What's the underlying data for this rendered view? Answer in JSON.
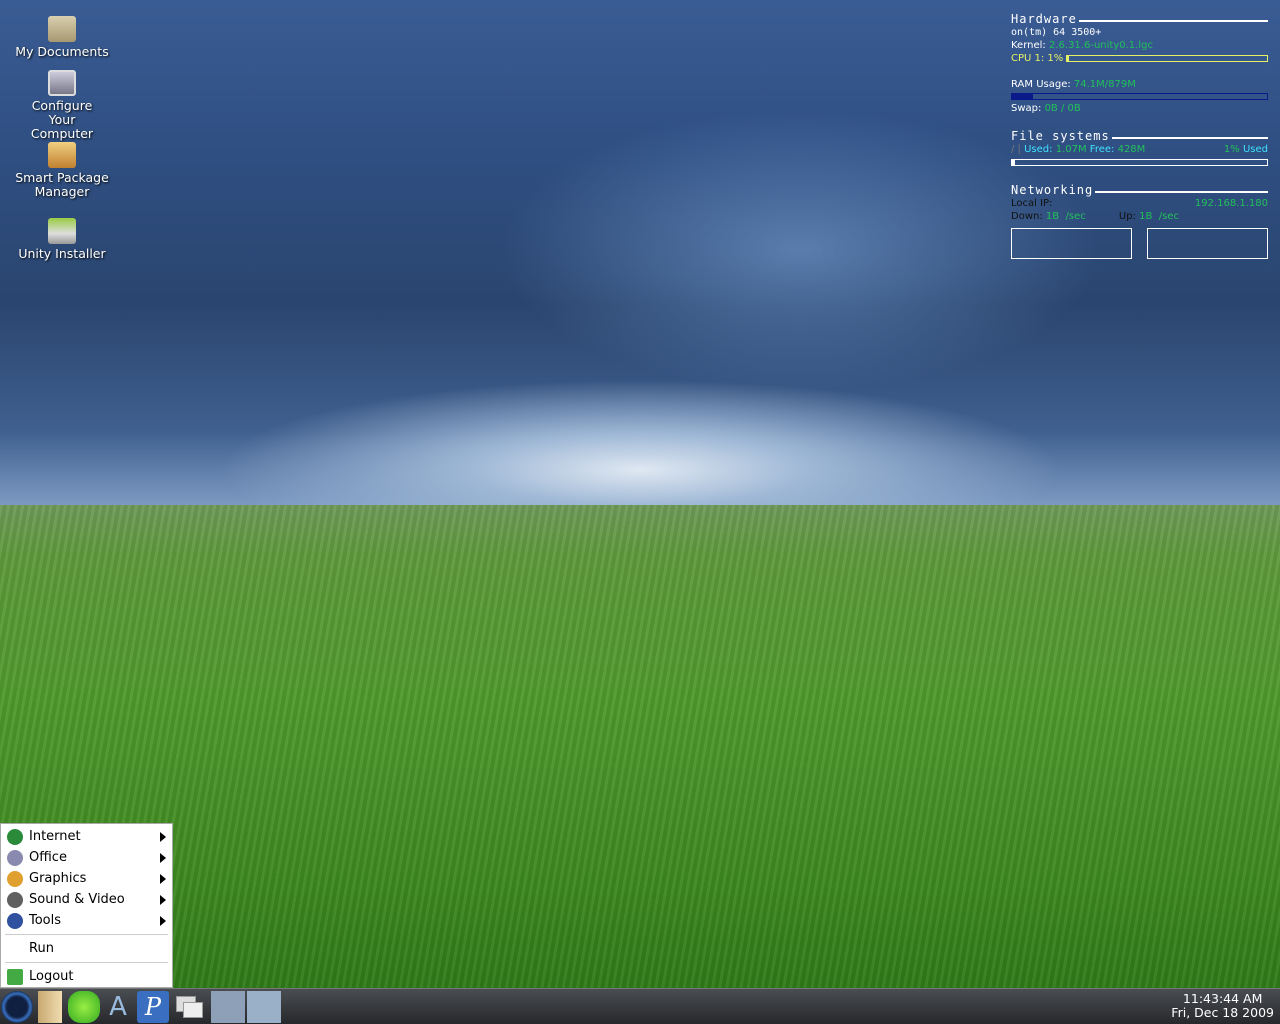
{
  "desktop_icons": [
    {
      "label": "My Documents",
      "icon": "folder-home-icon"
    },
    {
      "label": "Configure Your Computer",
      "icon": "monitor-config-icon"
    },
    {
      "label": "Smart Package Manager",
      "icon": "package-icon"
    },
    {
      "label": "Unity Installer",
      "icon": "installer-drive-icon"
    }
  ],
  "conky": {
    "hardware_title": "Hardware",
    "cpu_name": "on(tm) 64 3500+",
    "kernel_label": "Kernel:",
    "kernel_value": "2.6.31.6-unity0.1.lgc",
    "cpu_label": "CPU 1: 1%",
    "cpu_percent": 1,
    "ram_label": "RAM Usage:",
    "ram_value": "74.1M/879M",
    "ram_percent": 8.4,
    "swap_label": "Swap:",
    "swap_value": "0B  / 0B",
    "fs_title": "File systems",
    "fs_mount": "/ |",
    "fs_used_label": "Used:",
    "fs_used": "1.07M",
    "fs_free_label": "Free:",
    "fs_free": "428M",
    "fs_pct": "1%",
    "fs_pct_label": "Used",
    "fs_percent": 1,
    "net_title": "Networking",
    "local_ip_label": "Local IP:",
    "local_ip": "192.168.1.180",
    "down_label": "Down:",
    "down_value": "1B  /sec",
    "up_label": "Up:",
    "up_value": "1B  /sec",
    "colors": {
      "green": "#22c05a",
      "cyan": "#3ee0ff",
      "yellow": "#e6f064",
      "ram_bar": "#0a1a8a"
    }
  },
  "menu": {
    "items": [
      {
        "label": "Internet",
        "icon": "globe-icon",
        "color": "#2a8a3a"
      },
      {
        "label": "Office",
        "icon": "office-icon",
        "color": "#8a8ab0"
      },
      {
        "label": "Graphics",
        "icon": "palette-icon",
        "color": "#e0a030"
      },
      {
        "label": "Sound & Video",
        "icon": "media-icon",
        "color": "#606060"
      },
      {
        "label": "Tools",
        "icon": "tools-icon",
        "color": "#3050a0"
      }
    ],
    "run": "Run",
    "logout": "Logout"
  },
  "taskbar": {
    "launchers": [
      "start-menu-icon",
      "file-manager-icon",
      "chat-icon",
      "inkscape-icon",
      "pidgin-icon",
      "show-desktop-icon"
    ],
    "time": "11:43:44 AM",
    "date": "Fri, Dec 18 2009"
  }
}
